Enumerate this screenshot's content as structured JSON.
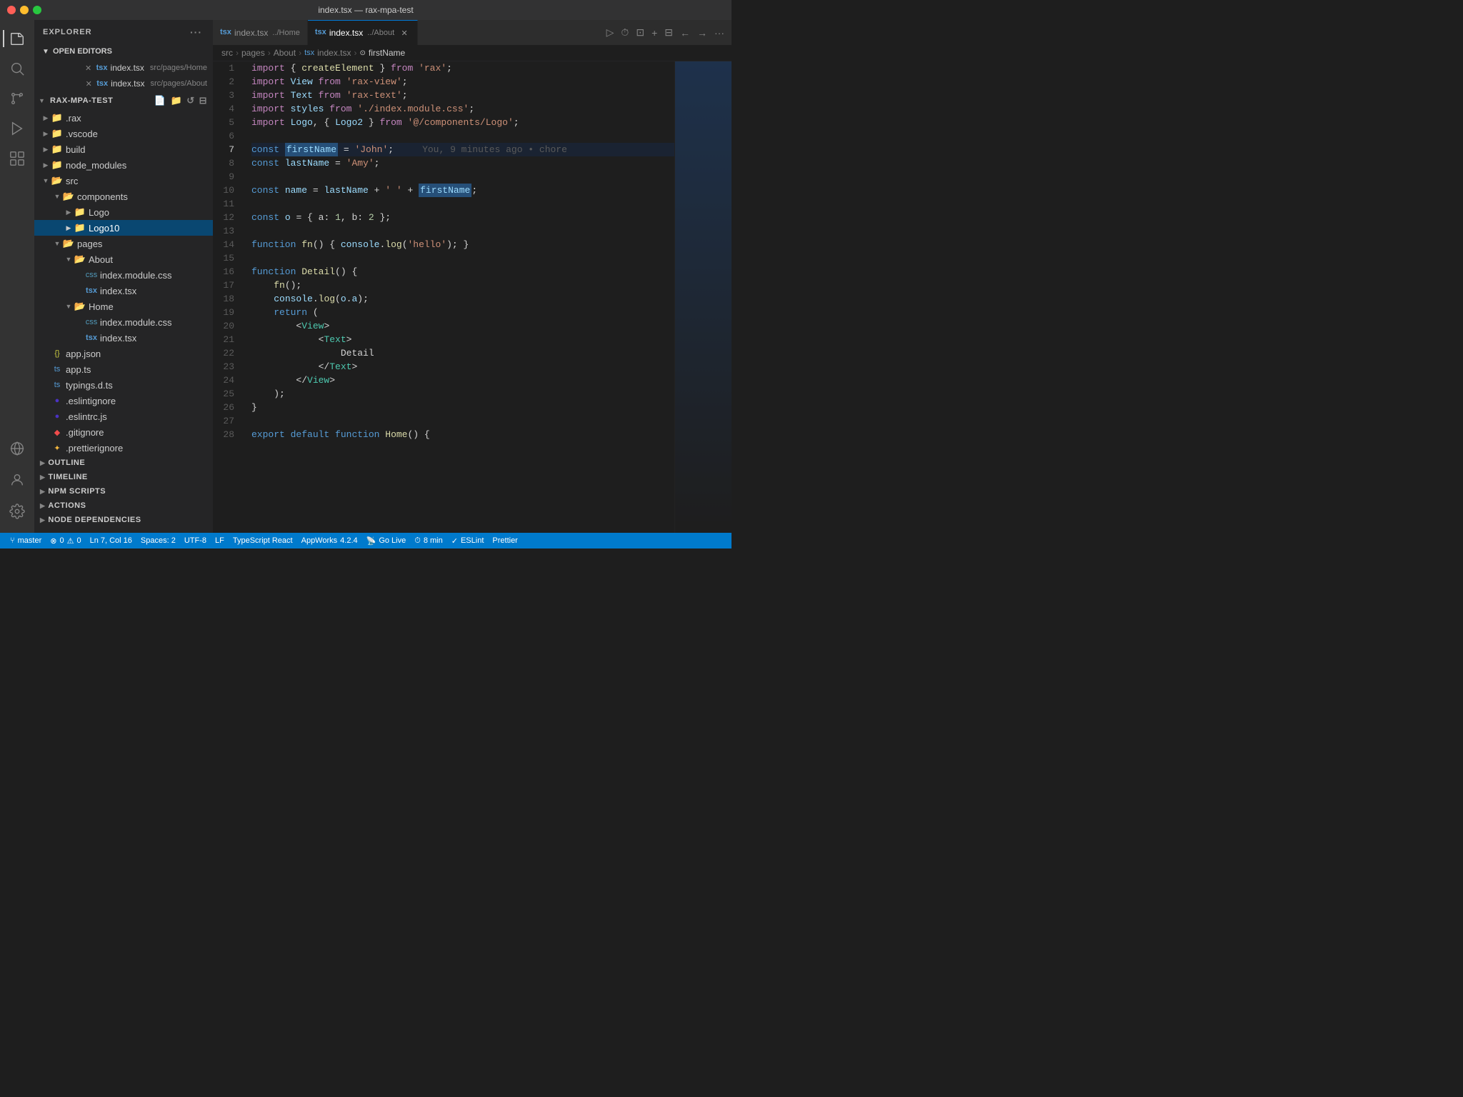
{
  "titleBar": {
    "title": "index.tsx — rax-mpa-test"
  },
  "activityBar": {
    "icons": [
      {
        "name": "explorer-icon",
        "symbol": "⊟",
        "active": true
      },
      {
        "name": "search-icon",
        "symbol": "🔍",
        "active": false
      },
      {
        "name": "source-control-icon",
        "symbol": "⑂",
        "active": false
      },
      {
        "name": "run-debug-icon",
        "symbol": "▷",
        "active": false
      },
      {
        "name": "extensions-icon",
        "symbol": "⊞",
        "active": false
      }
    ],
    "bottomIcons": [
      {
        "name": "remote-icon",
        "symbol": "⌥"
      },
      {
        "name": "account-icon",
        "symbol": "◯"
      },
      {
        "name": "settings-icon",
        "symbol": "⚙"
      }
    ]
  },
  "sidebar": {
    "header": "EXPLORER",
    "openEditors": {
      "label": "OPEN EDITORS",
      "items": [
        {
          "name": "index.tsx",
          "path": "src/pages/Home",
          "icon": "tsx"
        },
        {
          "name": "index.tsx",
          "path": "src/pages/About",
          "icon": "tsx",
          "modified": true
        }
      ]
    },
    "projectName": "RAX-MPA-TEST",
    "tree": [
      {
        "label": ".rax",
        "type": "folder",
        "depth": 1,
        "collapsed": true
      },
      {
        "label": ".vscode",
        "type": "folder",
        "depth": 1,
        "collapsed": true
      },
      {
        "label": "build",
        "type": "folder",
        "depth": 1,
        "collapsed": true
      },
      {
        "label": "node_modules",
        "type": "folder",
        "depth": 1,
        "collapsed": true
      },
      {
        "label": "src",
        "type": "folder",
        "depth": 1,
        "expanded": true
      },
      {
        "label": "components",
        "type": "folder",
        "depth": 2,
        "expanded": true
      },
      {
        "label": "Logo",
        "type": "folder",
        "depth": 3,
        "collapsed": true
      },
      {
        "label": "Logo10",
        "type": "folder",
        "depth": 3,
        "selected": true
      },
      {
        "label": "pages",
        "type": "folder",
        "depth": 2,
        "expanded": true
      },
      {
        "label": "About",
        "type": "folder",
        "depth": 3,
        "expanded": true
      },
      {
        "label": "index.module.css",
        "type": "css",
        "depth": 4
      },
      {
        "label": "index.tsx",
        "type": "tsx",
        "depth": 4
      },
      {
        "label": "Home",
        "type": "folder",
        "depth": 3,
        "expanded": true
      },
      {
        "label": "index.module.css",
        "type": "css",
        "depth": 4
      },
      {
        "label": "index.tsx",
        "type": "tsx",
        "depth": 4
      },
      {
        "label": "app.json",
        "type": "json",
        "depth": 1
      },
      {
        "label": "app.ts",
        "type": "ts",
        "depth": 1
      },
      {
        "label": "typings.d.ts",
        "type": "ts",
        "depth": 1
      },
      {
        "label": ".eslintignore",
        "type": "eslint",
        "depth": 1
      },
      {
        "label": ".eslintrc.js",
        "type": "eslint",
        "depth": 1
      },
      {
        "label": ".gitignore",
        "type": "git",
        "depth": 1
      },
      {
        "label": ".prettierignore",
        "type": "prettier",
        "depth": 1
      }
    ],
    "collapsedSections": [
      {
        "label": "OUTLINE"
      },
      {
        "label": "TIMELINE"
      },
      {
        "label": "NPM SCRIPTS"
      },
      {
        "label": "ACTIONS"
      },
      {
        "label": "NODE DEPENDENCIES"
      }
    ]
  },
  "tabs": [
    {
      "label": "index.tsx",
      "path": "../Home",
      "icon": "tsx",
      "active": false
    },
    {
      "label": "index.tsx",
      "path": "../About",
      "icon": "tsx",
      "active": true,
      "closable": true
    }
  ],
  "breadcrumb": {
    "items": [
      "src",
      "pages",
      "About",
      "index.tsx",
      "firstName"
    ]
  },
  "editor": {
    "lines": [
      {
        "num": 1,
        "content": "import_line_1"
      },
      {
        "num": 2,
        "content": "import_line_2"
      },
      {
        "num": 3,
        "content": "import_line_3"
      },
      {
        "num": 4,
        "content": "import_line_4"
      },
      {
        "num": 5,
        "content": "import_line_5"
      },
      {
        "num": 6,
        "content": "blank"
      },
      {
        "num": 7,
        "content": "firstName_line",
        "blame": "You, 9 minutes ago • chore"
      },
      {
        "num": 8,
        "content": "lastName_line"
      },
      {
        "num": 9,
        "content": "blank"
      },
      {
        "num": 10,
        "content": "name_line"
      },
      {
        "num": 11,
        "content": "blank"
      },
      {
        "num": 12,
        "content": "obj_line"
      },
      {
        "num": 13,
        "content": "blank"
      },
      {
        "num": 14,
        "content": "fn_line"
      },
      {
        "num": 15,
        "content": "blank"
      },
      {
        "num": 16,
        "content": "detail_fn_line"
      },
      {
        "num": 17,
        "content": "fn_call_line"
      },
      {
        "num": 18,
        "content": "console_log_line"
      },
      {
        "num": 19,
        "content": "return_line"
      },
      {
        "num": 20,
        "content": "view_open_line"
      },
      {
        "num": 21,
        "content": "text_open_line"
      },
      {
        "num": 22,
        "content": "detail_text_line"
      },
      {
        "num": 23,
        "content": "text_close_line"
      },
      {
        "num": 24,
        "content": "view_close_line"
      },
      {
        "num": 25,
        "content": "paren_line"
      },
      {
        "num": 26,
        "content": "brace_close_line"
      },
      {
        "num": 27,
        "content": "blank"
      },
      {
        "num": 28,
        "content": "export_line"
      }
    ]
  },
  "statusBar": {
    "branch": "master",
    "errors": "0",
    "warnings": "0",
    "position": "Ln 7, Col 16",
    "spaces": "Spaces: 2",
    "encoding": "UTF-8",
    "lineEnding": "LF",
    "language": "TypeScript React",
    "appworks": "AppWorks",
    "version": "4.2.4",
    "golive": "Go Live",
    "timer": "8 min",
    "eslint": "ESLint",
    "prettier": "Prettier"
  }
}
